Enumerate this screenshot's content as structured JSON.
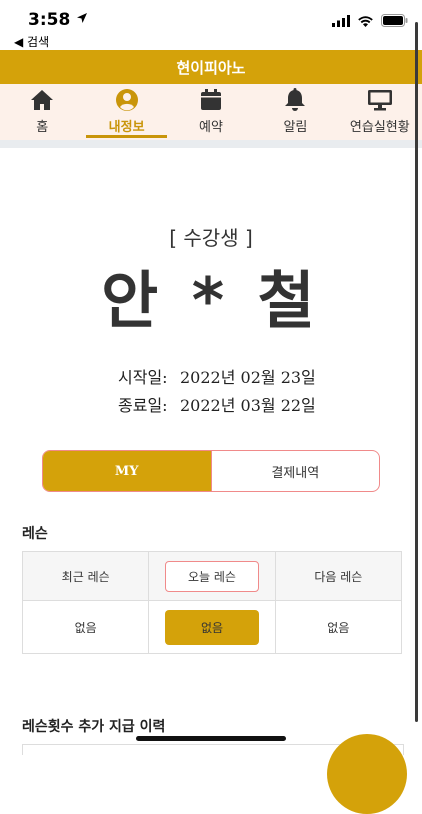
{
  "status_bar": {
    "time": "3:58",
    "back_label": "◀ 검색"
  },
  "header": {
    "title": "현이피아노"
  },
  "nav": {
    "items": [
      {
        "label": "홈",
        "icon": "home-icon"
      },
      {
        "label": "내정보",
        "icon": "user-circle-icon",
        "active": true
      },
      {
        "label": "예약",
        "icon": "calendar-icon"
      },
      {
        "label": "알림",
        "icon": "bell-icon"
      },
      {
        "label": "연습실현황",
        "icon": "monitor-icon"
      }
    ]
  },
  "profile": {
    "role": "[ 수강생 ]",
    "name": "안 * 철",
    "start_label": "시작일:",
    "start_date": "2022년 02월 23일",
    "end_label": "종료일:",
    "end_date": "2022년 03월 22일"
  },
  "tabs": {
    "my": "MY",
    "payments": "결제내역"
  },
  "lesson": {
    "title": "레슨",
    "headers": [
      "최근 레슨",
      "오늘 레슨",
      "다음 레슨"
    ],
    "values": [
      "없음",
      "없음",
      "없음"
    ]
  },
  "history": {
    "title": "레슨횟수 추가 지급 이력"
  },
  "colors": {
    "brand": "#d4a20a",
    "nav_bg": "#fdf1ea",
    "accent_border": "#f08a8a"
  }
}
